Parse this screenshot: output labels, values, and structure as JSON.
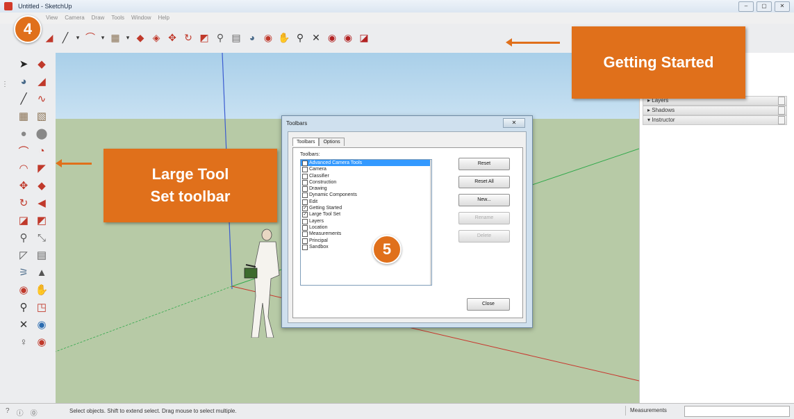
{
  "window": {
    "title": "Untitled - SketchUp",
    "controls": [
      "–",
      "▢",
      "✕"
    ]
  },
  "menubar": {
    "items": [
      "View",
      "Camera",
      "Draw",
      "Tools",
      "Window",
      "Help"
    ]
  },
  "top_toolbar": {
    "icons": [
      "eraser-icon",
      "pencil-icon",
      "dropdown-icon",
      "arc-icon",
      "dropdown-icon",
      "rectangle-icon",
      "dropdown-icon",
      "push-pull-icon",
      "follow-me-icon",
      "move-icon",
      "rotate-icon",
      "scale-icon",
      "tape-icon",
      "text-icon",
      "paint-icon",
      "orbit-icon",
      "pan-icon",
      "zoom-icon",
      "zoom-extents-icon",
      "warehouse-icon",
      "components-icon",
      "extension-icon"
    ],
    "glyphs": [
      "◢",
      "╱",
      "▾",
      "⌒",
      "▾",
      "▦",
      "▾",
      "◆",
      "◈",
      "✥",
      "↻",
      "◩",
      "⚲",
      "▤",
      "◕",
      "◉",
      "✋",
      "⚲",
      "✕",
      "◉",
      "◉",
      "◪"
    ],
    "colors": [
      "#c0392b",
      "#333",
      "#333",
      "#c0392b",
      "#333",
      "#8b7355",
      "#333",
      "#c0392b",
      "#c0392b",
      "#c0392b",
      "#c0392b",
      "#c0392b",
      "#555",
      "#666",
      "#4a6b8a",
      "#c0392b",
      "#c08a2a",
      "#333",
      "#333",
      "#b22222",
      "#b22222",
      "#b22222"
    ]
  },
  "left_toolbar": {
    "icons": [
      "select-icon",
      "component-icon",
      "paint-bucket-icon",
      "eraser-icon",
      "line-icon",
      "freehand-icon",
      "rectangle-icon",
      "rotated-rectangle-icon",
      "circle-icon",
      "polygon-icon",
      "arc-icon",
      "pie-icon",
      "arc-2-icon",
      "follow-me-icon",
      "move-icon",
      "push-pull-icon",
      "rotate-icon",
      "offset-icon",
      "scale-icon",
      "follow-icon",
      "tape-icon",
      "dimension-icon",
      "protractor-icon",
      "text-icon",
      "axes-icon",
      "3d-text-icon",
      "orbit-icon",
      "pan-icon",
      "zoom-icon",
      "zoom-window-icon",
      "zoom-extents-icon",
      "previous-icon",
      "walk-icon",
      "look-around-icon"
    ],
    "glyphs": [
      "➤",
      "◆",
      "◕",
      "◢",
      "╱",
      "∿",
      "▦",
      "▧",
      "●",
      "⬤",
      "⌒",
      "◔",
      "◠",
      "◤",
      "✥",
      "◆",
      "↻",
      "◀",
      "◪",
      "◩",
      "⚲",
      "⤡",
      "◸",
      "▤",
      "⚞",
      "▲",
      "◉",
      "✋",
      "⚲",
      "◳",
      "✕",
      "◉",
      "♀",
      "◉"
    ],
    "colors": [
      "#222",
      "#c0392b",
      "#4a6b8a",
      "#c0392b",
      "#333",
      "#c0392b",
      "#8b7355",
      "#8b7355",
      "#888",
      "#888",
      "#c0392b",
      "#c0392b",
      "#c0392b",
      "#c0392b",
      "#c0392b",
      "#c0392b",
      "#c0392b",
      "#c0392b",
      "#c0392b",
      "#c0392b",
      "#555",
      "#666",
      "#555",
      "#666",
      "#4a6b8a",
      "#555",
      "#c0392b",
      "#c08a2a",
      "#333",
      "#c0392b",
      "#333",
      "#2a6bb0",
      "#555",
      "#c0392b"
    ]
  },
  "right_panel": {
    "rows": [
      "Layers",
      "Shadows",
      "Instructor"
    ],
    "prefixes": [
      "▸",
      "▸",
      "▾"
    ]
  },
  "dialog": {
    "title": "Toolbars",
    "close": "✕",
    "tabs": [
      "Toolbars",
      "Options"
    ],
    "list_label": "Toolbars:",
    "items": [
      {
        "label": "Advanced Camera Tools",
        "checked": false,
        "selected": true
      },
      {
        "label": "Camera",
        "checked": false,
        "selected": false
      },
      {
        "label": "Classifier",
        "checked": false,
        "selected": false
      },
      {
        "label": "Construction",
        "checked": false,
        "selected": false
      },
      {
        "label": "Drawing",
        "checked": false,
        "selected": false
      },
      {
        "label": "Dynamic Components",
        "checked": false,
        "selected": false
      },
      {
        "label": "Edit",
        "checked": false,
        "selected": false
      },
      {
        "label": "Getting Started",
        "checked": true,
        "selected": false
      },
      {
        "label": "Large Tool Set",
        "checked": true,
        "selected": false
      },
      {
        "label": "Layers",
        "checked": false,
        "selected": false
      },
      {
        "label": "Location",
        "checked": false,
        "selected": false
      },
      {
        "label": "Measurements",
        "checked": false,
        "selected": false
      },
      {
        "label": "Principal",
        "checked": false,
        "selected": false
      },
      {
        "label": "Sandbox",
        "checked": false,
        "selected": false
      }
    ],
    "buttons": {
      "reset": "Reset",
      "reset_all": "Reset All",
      "new": "New...",
      "rename": "Rename",
      "delete": "Delete",
      "close": "Close"
    }
  },
  "callouts": {
    "getting_started": "Getting Started",
    "large_tool_set": "Large Tool Set toolbar",
    "badge_4": "4",
    "badge_5": "5",
    "color": "#e0701b"
  },
  "statusbar": {
    "icons": [
      "?",
      "ⓘ",
      "⓪"
    ],
    "message": "Select objects. Shift to extend select. Drag mouse to select multiple.",
    "measurements_label": "Measurements"
  }
}
